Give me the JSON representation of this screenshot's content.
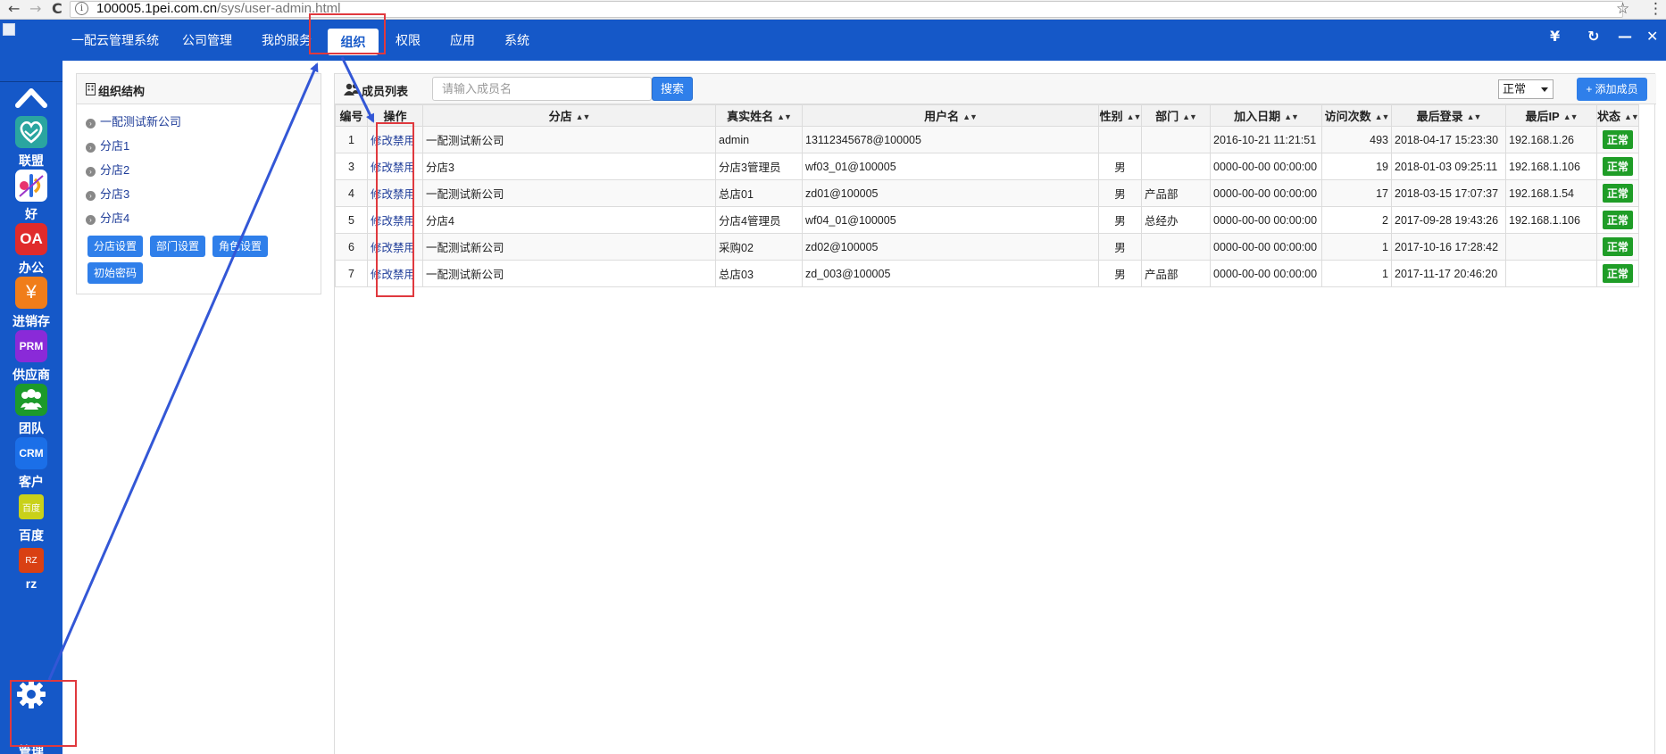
{
  "browser": {
    "url_host": "100005.1pei.com.cn",
    "url_path": "/sys/user-admin.html",
    "back_glyph": "←",
    "forward_glyph": "→",
    "reload_glyph": "C",
    "star_glyph": "☆",
    "menu_glyph": "⋮"
  },
  "top_nav": {
    "items": [
      {
        "label": "一配云管理系统"
      },
      {
        "label": "公司管理"
      },
      {
        "label": "我的服务"
      },
      {
        "label": "组织"
      },
      {
        "label": "权限"
      },
      {
        "label": "应用"
      },
      {
        "label": "系统"
      }
    ],
    "active_index": 3,
    "controls": {
      "yen": "¥",
      "refresh": "↻",
      "minimize": "—",
      "close": "✕"
    }
  },
  "sidebar": {
    "items": [
      {
        "label": "联盟",
        "icon": "handshake-heart-icon",
        "color": "#2aa5a0"
      },
      {
        "label": "好",
        "icon": "love-colorful-icon",
        "color": "#ffffff"
      },
      {
        "label": "办公",
        "icon": "oa-icon",
        "icon_text": "OA",
        "color": "#e02b2b"
      },
      {
        "label": "进销存",
        "icon": "yen-icon",
        "icon_text": "¥",
        "color": "#f07d1a"
      },
      {
        "label": "供应商",
        "icon": "prm-icon",
        "icon_text": "PRM",
        "color": "#8a2ad8"
      },
      {
        "label": "团队",
        "icon": "team-icon",
        "color": "#1c9a2a"
      },
      {
        "label": "客户",
        "icon": "crm-icon",
        "icon_text": "CRM",
        "color": "#1b6fe8"
      },
      {
        "label": "百度",
        "icon": "baidu-icon",
        "icon_text": "百度",
        "color": "#c9d11a"
      },
      {
        "label": "rz",
        "icon": "rz-icon",
        "icon_text": "RZ",
        "color": "#d94013"
      },
      {
        "label": "管理",
        "icon": "gear-icon",
        "color": "#ffffff"
      }
    ]
  },
  "org_panel": {
    "title": "组织结构",
    "tree": [
      "一配测试新公司",
      "分店1",
      "分店2",
      "分店3",
      "分店4"
    ],
    "buttons": [
      "分店设置",
      "部门设置",
      "角色设置",
      "初始密码"
    ]
  },
  "member_panel": {
    "title": "成员列表",
    "search_placeholder": "请输入成员名",
    "search_label": "搜索",
    "status_filter": "正常",
    "add_label": "+ 添加成员",
    "columns": [
      "编号",
      "操作",
      "分店",
      "真实姓名",
      "用户名",
      "性别",
      "部门",
      "加入日期",
      "访问次数",
      "最后登录",
      "最后IP",
      "状态"
    ],
    "rows": [
      {
        "id": "1",
        "edit": "修改",
        "disable": "禁用",
        "branch": "一配测试新公司",
        "real_name": "admin",
        "username": "13112345678@100005",
        "gender": "",
        "dept": "",
        "join_date": "2016-10-21 11:21:51",
        "visits": "493",
        "last_login": "2018-04-17 15:23:30",
        "last_ip": "192.168.1.26",
        "status": "正常"
      },
      {
        "id": "3",
        "edit": "修改",
        "disable": "禁用",
        "branch": "分店3",
        "real_name": "分店3管理员",
        "username": "wf03_01@100005",
        "gender": "男",
        "dept": "",
        "join_date": "0000-00-00 00:00:00",
        "visits": "19",
        "last_login": "2018-01-03 09:25:11",
        "last_ip": "192.168.1.106",
        "status": "正常"
      },
      {
        "id": "4",
        "edit": "修改",
        "disable": "禁用",
        "branch": "一配测试新公司",
        "real_name": "总店01",
        "username": "zd01@100005",
        "gender": "男",
        "dept": "产品部",
        "join_date": "0000-00-00 00:00:00",
        "visits": "17",
        "last_login": "2018-03-15 17:07:37",
        "last_ip": "192.168.1.54",
        "status": "正常"
      },
      {
        "id": "5",
        "edit": "修改",
        "disable": "禁用",
        "branch": "分店4",
        "real_name": "分店4管理员",
        "username": "wf04_01@100005",
        "gender": "男",
        "dept": "总经办",
        "join_date": "0000-00-00 00:00:00",
        "visits": "2",
        "last_login": "2017-09-28 19:43:26",
        "last_ip": "192.168.1.106",
        "status": "正常"
      },
      {
        "id": "6",
        "edit": "修改",
        "disable": "禁用",
        "branch": "一配测试新公司",
        "real_name": "采购02",
        "username": "zd02@100005",
        "gender": "男",
        "dept": "",
        "join_date": "0000-00-00 00:00:00",
        "visits": "1",
        "last_login": "2017-10-16 17:28:42",
        "last_ip": "",
        "status": "正常"
      },
      {
        "id": "7",
        "edit": "修改",
        "disable": "禁用",
        "branch": "一配测试新公司",
        "real_name": "总店03",
        "username": "zd_003@100005",
        "gender": "男",
        "dept": "产品部",
        "join_date": "0000-00-00 00:00:00",
        "visits": "1",
        "last_login": "2017-11-17 20:46:20",
        "last_ip": "",
        "status": "正常"
      }
    ]
  },
  "colors": {
    "brand_blue": "#1558c8",
    "button_blue": "#2f7fea",
    "status_green": "#1f9d27",
    "annotation_red": "#e0393e",
    "annotation_arrow": "#3357d6"
  }
}
